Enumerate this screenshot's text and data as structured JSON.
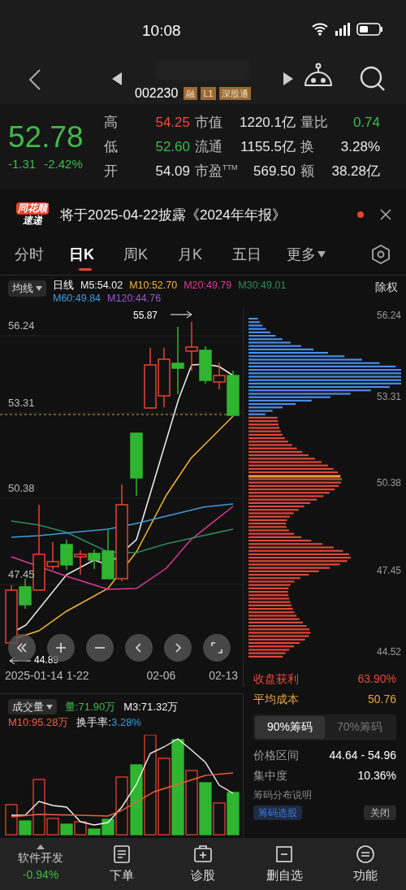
{
  "status_bar": {
    "time": "10:08"
  },
  "header": {
    "code": "002230",
    "badges": [
      "融",
      "L1",
      "深股通"
    ]
  },
  "quote": {
    "price": "52.78",
    "change": "-1.31",
    "change_pct": "-2.42%",
    "color": "#3dbb4a",
    "stats": [
      {
        "label": "高",
        "value": "54.25",
        "color": "#f04b3e"
      },
      {
        "label": "市值",
        "value": "1220.1亿",
        "color": "#e8e8e8"
      },
      {
        "label": "量比",
        "value": "0.74",
        "color": "#3dbb4a"
      },
      {
        "label": "低",
        "value": "52.60",
        "color": "#3dbb4a"
      },
      {
        "label": "流通",
        "value": "1155.5亿",
        "color": "#e8e8e8"
      },
      {
        "label": "换",
        "value": "3.28%",
        "color": "#e8e8e8"
      },
      {
        "label": "开",
        "value": "54.09",
        "color": "#e8e8e8"
      },
      {
        "label": "市盈$^{TTM}$",
        "value": "569.50",
        "color": "#e8e8e8"
      },
      {
        "label": "额",
        "value": "38.28亿",
        "color": "#e8e8e8"
      }
    ]
  },
  "notice": {
    "brand": [
      "同花顺",
      "速递"
    ],
    "text": "将于2025-04-22披露《2024年年报》",
    "unread": true
  },
  "period_tabs": [
    {
      "label": "分时",
      "selected": false,
      "dropdown": false
    },
    {
      "label": "日K",
      "selected": true,
      "dropdown": false
    },
    {
      "label": "周K",
      "selected": false,
      "dropdown": false
    },
    {
      "label": "月K",
      "selected": false,
      "dropdown": false
    },
    {
      "label": "五日",
      "selected": false,
      "dropdown": false
    },
    {
      "label": "更多",
      "selected": false,
      "dropdown": true
    }
  ],
  "ma_legend": {
    "selector": "均线",
    "title": "日线",
    "adjust": "除权",
    "items": [
      {
        "label": "M5:54.02",
        "color": "#f2f2f2"
      },
      {
        "label": "M10:52.70",
        "color": "#f5b335"
      },
      {
        "label": "M20:49.79",
        "color": "#e0399a"
      },
      {
        "label": "M30:49.01",
        "color": "#2f8a5c"
      },
      {
        "label": "M60:49.84",
        "color": "#3d9be0"
      },
      {
        "label": "M120:44.76",
        "color": "#9b59d0"
      }
    ]
  },
  "kline": {
    "yticks": [
      "56.24",
      "53.31",
      "50.38",
      "47.45"
    ],
    "high_mark": "55.87",
    "low_mark": "44.89",
    "dates": [
      "2025-01-14",
      "1-22",
      "02-06",
      "02-13"
    ]
  },
  "chips": {
    "yticks": [
      "56.24",
      "53.31",
      "50.38",
      "47.45",
      "44.52"
    ],
    "profit": {
      "label": "收盘获利",
      "value": "63.90%"
    },
    "avg_cost": {
      "label": "平均成本",
      "value": "50.76"
    },
    "tabs": [
      {
        "label": "90%筹码",
        "selected": true
      },
      {
        "label": "70%筹码",
        "selected": false
      }
    ],
    "rows": [
      {
        "label": "价格区间",
        "value": "44.64 - 54.96"
      },
      {
        "label": "集中度",
        "value": "10.36%"
      }
    ],
    "help": "筹码分布说明",
    "pick": "筹码选股",
    "close": "关闭"
  },
  "volume": {
    "selector": "成交量",
    "legend": [
      {
        "label": "量:71.90万",
        "color": "#3dbb4a"
      },
      {
        "label": "M3:71.32万",
        "color": "#f2f2f2"
      },
      {
        "label": "M10:95.28万",
        "color": "#f0603a"
      }
    ],
    "turnover_label": "换手率:",
    "turnover": "3.28%"
  },
  "bottom_nav": [
    {
      "kind": "sector",
      "label": "软件开发",
      "sub": "-0.94%"
    },
    {
      "kind": "order",
      "label": "下单"
    },
    {
      "kind": "diagnose",
      "label": "诊股"
    },
    {
      "kind": "remove",
      "label": "删自选"
    },
    {
      "kind": "menu",
      "label": "功能"
    }
  ]
}
